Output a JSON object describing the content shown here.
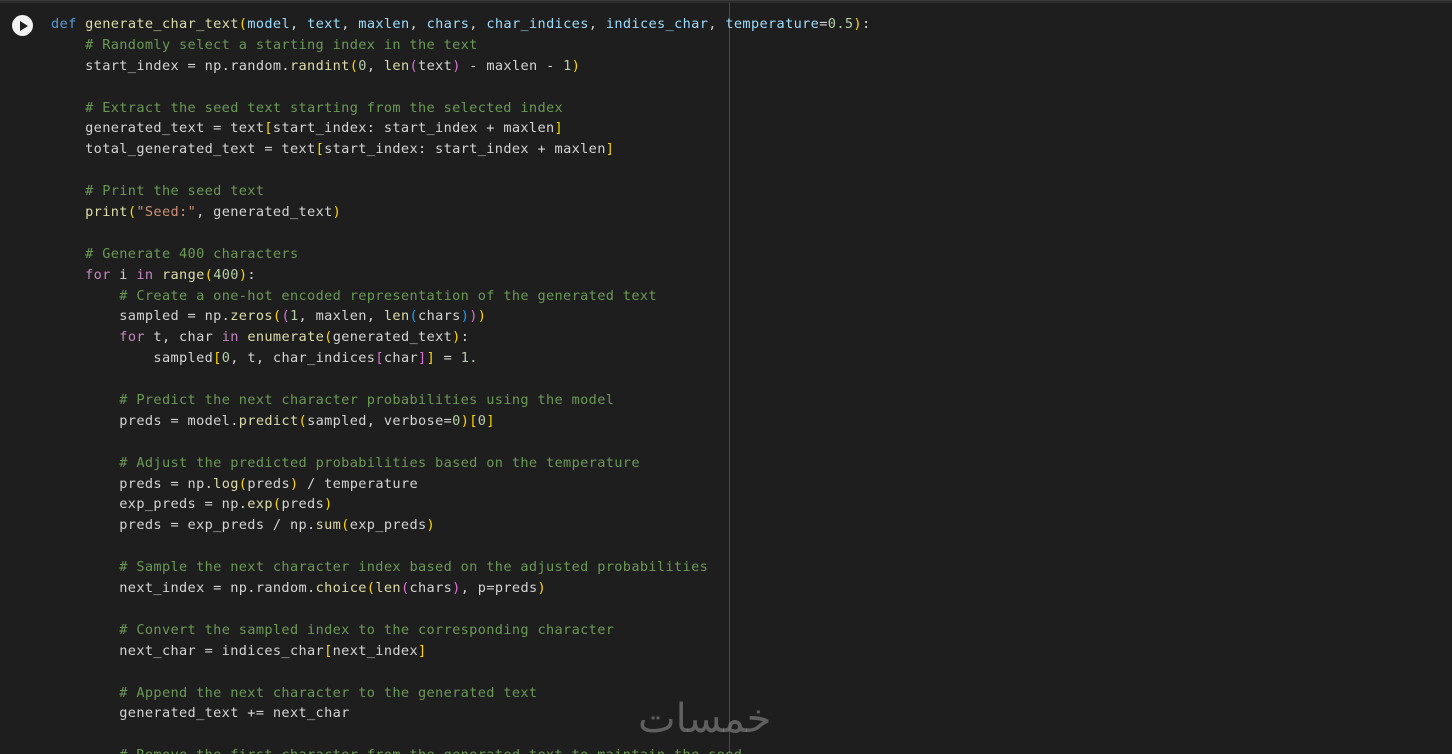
{
  "cell": {
    "run_button_icon": "play-icon"
  },
  "watermark": {
    "text": "خمسات"
  },
  "code_lines": [
    "def generate_char_text(model, text, maxlen, chars, char_indices, indices_char, temperature=0.5):",
    "    # Randomly select a starting index in the text",
    "    start_index = np.random.randint(0, len(text) - maxlen - 1)",
    "",
    "    # Extract the seed text starting from the selected index",
    "    generated_text = text[start_index: start_index + maxlen]",
    "    total_generated_text = text[start_index: start_index + maxlen]",
    "",
    "    # Print the seed text",
    "    print(\"Seed:\", generated_text)",
    "",
    "    # Generate 400 characters",
    "    for i in range(400):",
    "        # Create a one-hot encoded representation of the generated text",
    "        sampled = np.zeros((1, maxlen, len(chars)))",
    "        for t, char in enumerate(generated_text):",
    "            sampled[0, t, char_indices[char]] = 1.",
    "",
    "        # Predict the next character probabilities using the model",
    "        preds = model.predict(sampled, verbose=0)[0]",
    "",
    "        # Adjust the predicted probabilities based on the temperature",
    "        preds = np.log(preds) / temperature",
    "        exp_preds = np.exp(preds)",
    "        preds = exp_preds / np.sum(exp_preds)",
    "",
    "        # Sample the next character index based on the adjusted probabilities",
    "        next_index = np.random.choice(len(chars), p=preds)",
    "",
    "        # Convert the sampled index to the corresponding character",
    "        next_char = indices_char[next_index]",
    "",
    "        # Append the next character to the generated text",
    "        generated_text += next_char",
    "",
    "        # Remove the first character from the generated text to maintain the seed"
  ],
  "colors": {
    "background": "#1e1e1e",
    "keyword": "#569cd6",
    "control": "#c586c0",
    "function": "#dcdcaa",
    "parameter": "#9cdcfe",
    "comment": "#6a9955",
    "number": "#b5cea8",
    "string": "#ce9178",
    "bracket_level1": "#ffd700",
    "bracket_level2": "#da70d6",
    "bracket_level3": "#179fff"
  }
}
